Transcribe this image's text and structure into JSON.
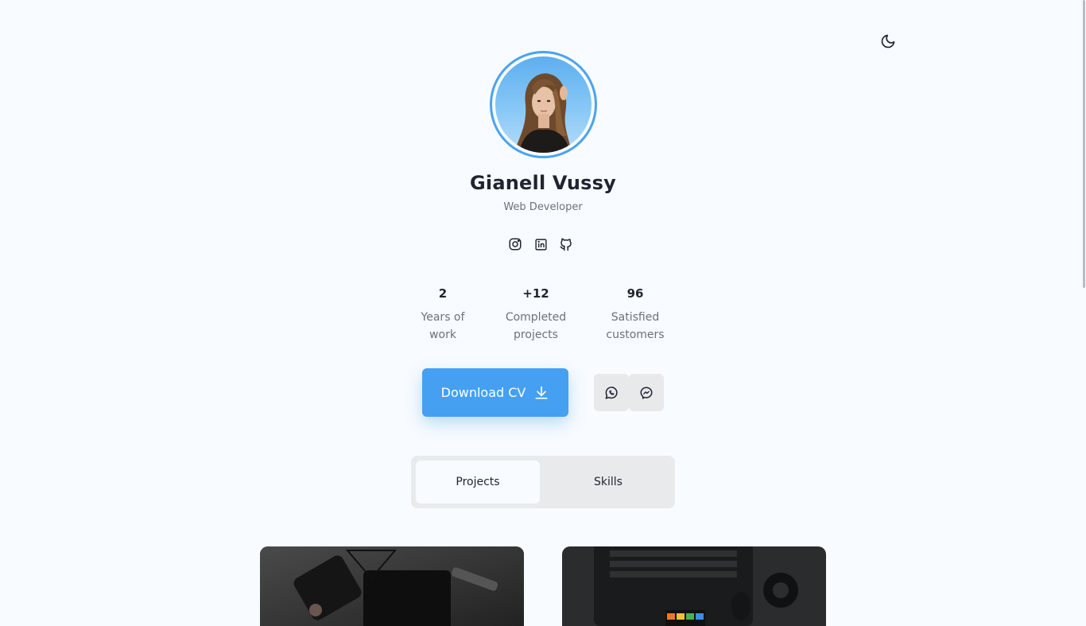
{
  "profile": {
    "name": "Gianell Vussy",
    "role": "Web Developer"
  },
  "socials": [
    {
      "icon": "instagram-icon"
    },
    {
      "icon": "linkedin-icon"
    },
    {
      "icon": "github-icon"
    }
  ],
  "stats": [
    {
      "value": "2",
      "label_line1": "Years of",
      "label_line2": "work"
    },
    {
      "value": "+12",
      "label_line1": "Completed",
      "label_line2": "projects"
    },
    {
      "value": "96",
      "label_line1": "Satisfied",
      "label_line2": "customers"
    }
  ],
  "actions": {
    "download_cv": "Download CV",
    "download_icon": "download-icon",
    "contact_icons": [
      "whatsapp-icon",
      "messenger-icon"
    ]
  },
  "tabs": [
    {
      "label": "Projects",
      "active": true
    },
    {
      "label": "Skills",
      "active": false
    }
  ],
  "header": {
    "theme_icon": "moon-icon"
  },
  "colors": {
    "accent": "#45a0f2",
    "background": "#f8fbff",
    "text": "#1f2430",
    "muted": "#6c717a"
  }
}
